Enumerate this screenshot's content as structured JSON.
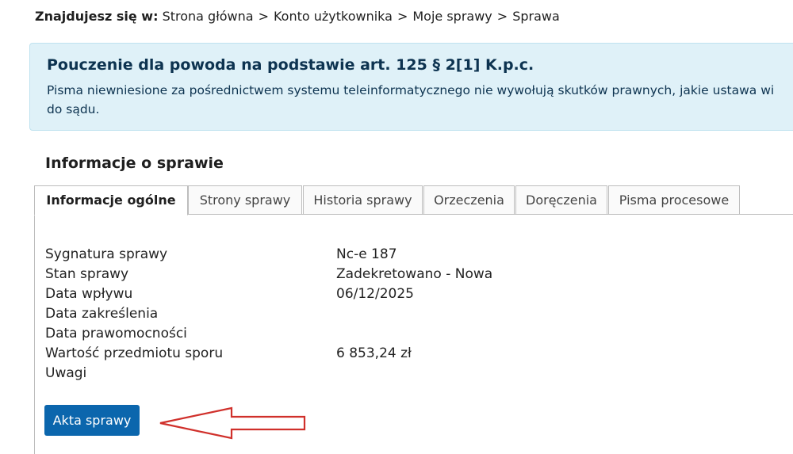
{
  "breadcrumb": {
    "lead": "Znajdujesz się w:",
    "items": [
      "Strona główna",
      "Konto użytkownika",
      "Moje sprawy",
      "Sprawa"
    ],
    "separator": ">"
  },
  "notice": {
    "title": "Pouczenie dla powoda na podstawie art. 125 § 2[1] K.p.c.",
    "line1": "Pisma niewniesione za pośrednictwem systemu teleinformatycznego nie wywołują skutków prawnych, jakie ustawa wi",
    "line2": "do sądu."
  },
  "section": {
    "title": "Informacje o sprawie"
  },
  "tabs": [
    {
      "label": "Informacje ogólne",
      "active": true
    },
    {
      "label": "Strony sprawy",
      "active": false
    },
    {
      "label": "Historia sprawy",
      "active": false
    },
    {
      "label": "Orzeczenia",
      "active": false
    },
    {
      "label": "Doręczenia",
      "active": false
    },
    {
      "label": "Pisma procesowe",
      "active": false
    }
  ],
  "details": [
    {
      "label": "Sygnatura sprawy",
      "value": "Nc-e 187"
    },
    {
      "label": "Stan sprawy",
      "value": "Zadekretowano - Nowa"
    },
    {
      "label": "Data wpływu",
      "value": "06/12/2025"
    },
    {
      "label": "Data zakreślenia",
      "value": ""
    },
    {
      "label": "Data prawomocności",
      "value": ""
    },
    {
      "label": "Wartość przedmiotu sporu",
      "value": "6 853,24 zł"
    },
    {
      "label": "Uwagi",
      "value": ""
    }
  ],
  "button": {
    "label": "Akta sprawy"
  },
  "annotation": {
    "icon": "red-outline-arrow-left-icon",
    "color": "#d0302b"
  },
  "colors": {
    "accent": "#0b66ad",
    "notice_bg": "#dff1f8",
    "notice_text": "#0d3350"
  }
}
